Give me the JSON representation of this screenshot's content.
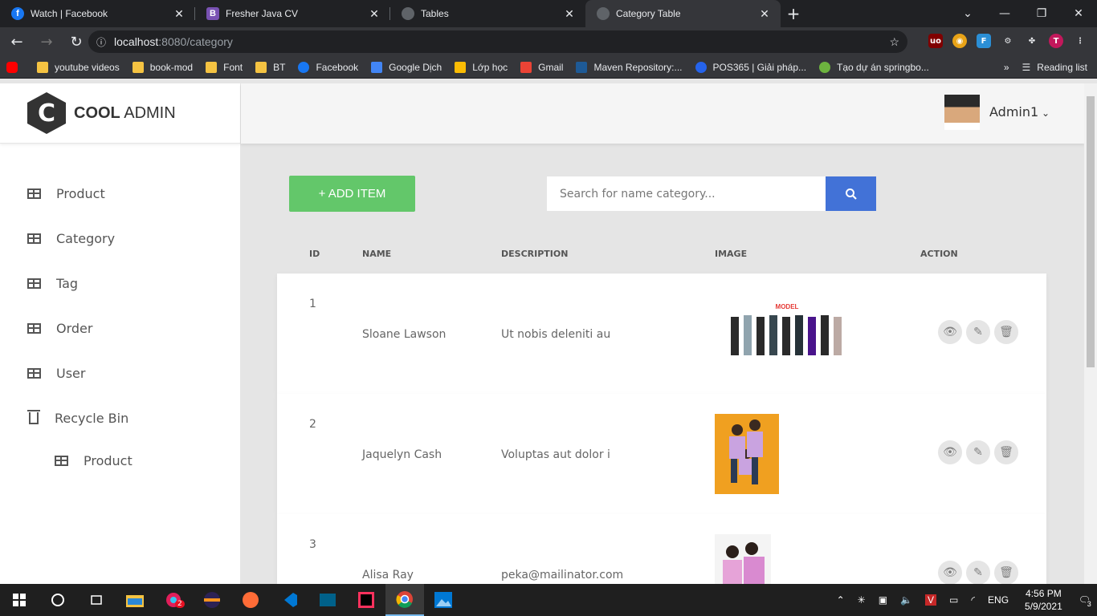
{
  "browser": {
    "tabs": [
      {
        "title": "Watch | Facebook",
        "icon": "facebook-icon",
        "color": "#1877f2",
        "glyph": "f"
      },
      {
        "title": "Fresher Java CV",
        "icon": "bootstrap-icon",
        "color": "#7952b3",
        "glyph": "B"
      },
      {
        "title": "Tables",
        "icon": "globe-icon",
        "color": "#5f6368",
        "glyph": ""
      },
      {
        "title": "Category Table",
        "icon": "globe-icon",
        "color": "#5f6368",
        "glyph": "",
        "active": true
      }
    ],
    "url_host": "localhost",
    "url_path": ":8080/category",
    "bookmarks": [
      {
        "label": "",
        "icon": "youtube-icon",
        "color": "#ff0000"
      },
      {
        "label": "youtube videos",
        "icon": "folder-icon",
        "color": "#f5c342"
      },
      {
        "label": "book-mod",
        "icon": "folder-icon",
        "color": "#f5c342"
      },
      {
        "label": "Font",
        "icon": "folder-icon",
        "color": "#f5c342"
      },
      {
        "label": "BT",
        "icon": "folder-icon",
        "color": "#f5c342"
      },
      {
        "label": "Facebook",
        "icon": "facebook-icon",
        "color": "#1877f2"
      },
      {
        "label": "Google Dịch",
        "icon": "translate-icon",
        "color": "#4285f4"
      },
      {
        "label": "Lớp học",
        "icon": "classroom-icon",
        "color": "#fbbc04"
      },
      {
        "label": "Gmail",
        "icon": "gmail-icon",
        "color": "#ea4335"
      },
      {
        "label": "Maven Repository:...",
        "icon": "maven-icon",
        "color": "#1e5a96"
      },
      {
        "label": "POS365 | Giải pháp...",
        "icon": "pos365-icon",
        "color": "#2563eb"
      },
      {
        "label": "Tạo dự án springbo...",
        "icon": "spring-icon",
        "color": "#6db33f"
      }
    ],
    "reading_list": "Reading list",
    "profile_initial": "T"
  },
  "sidebar": {
    "logo_letter": "C",
    "logo_bold": "COOL",
    "logo_rest": "ADMIN",
    "items": [
      {
        "label": "Product"
      },
      {
        "label": "Category"
      },
      {
        "label": "Tag"
      },
      {
        "label": "Order"
      },
      {
        "label": "User"
      }
    ],
    "recycle_bin": "Recycle Bin",
    "recycle_sub": "Product"
  },
  "header": {
    "user_name": "Admin1"
  },
  "toolbar": {
    "add_label": "+ ADD ITEM",
    "search_placeholder": "Search for name category..."
  },
  "table": {
    "columns": [
      "ID",
      "NAME",
      "DESCRIPTION",
      "IMAGE",
      "ACTION"
    ],
    "rows": [
      {
        "id": "1",
        "name": "Sloane Lawson",
        "description": "Ut nobis deleniti au",
        "image_caption": "MODEL"
      },
      {
        "id": "2",
        "name": "Jaquelyn Cash",
        "description": "Voluptas aut dolor i",
        "image_caption": ""
      },
      {
        "id": "3",
        "name": "Alisa Ray",
        "description": "peka@mailinator.com",
        "image_caption": ""
      }
    ]
  },
  "taskbar": {
    "time": "4:56 PM",
    "date": "5/9/2021",
    "lang": "ENG",
    "notifications": "3",
    "slack_badge": "2"
  }
}
